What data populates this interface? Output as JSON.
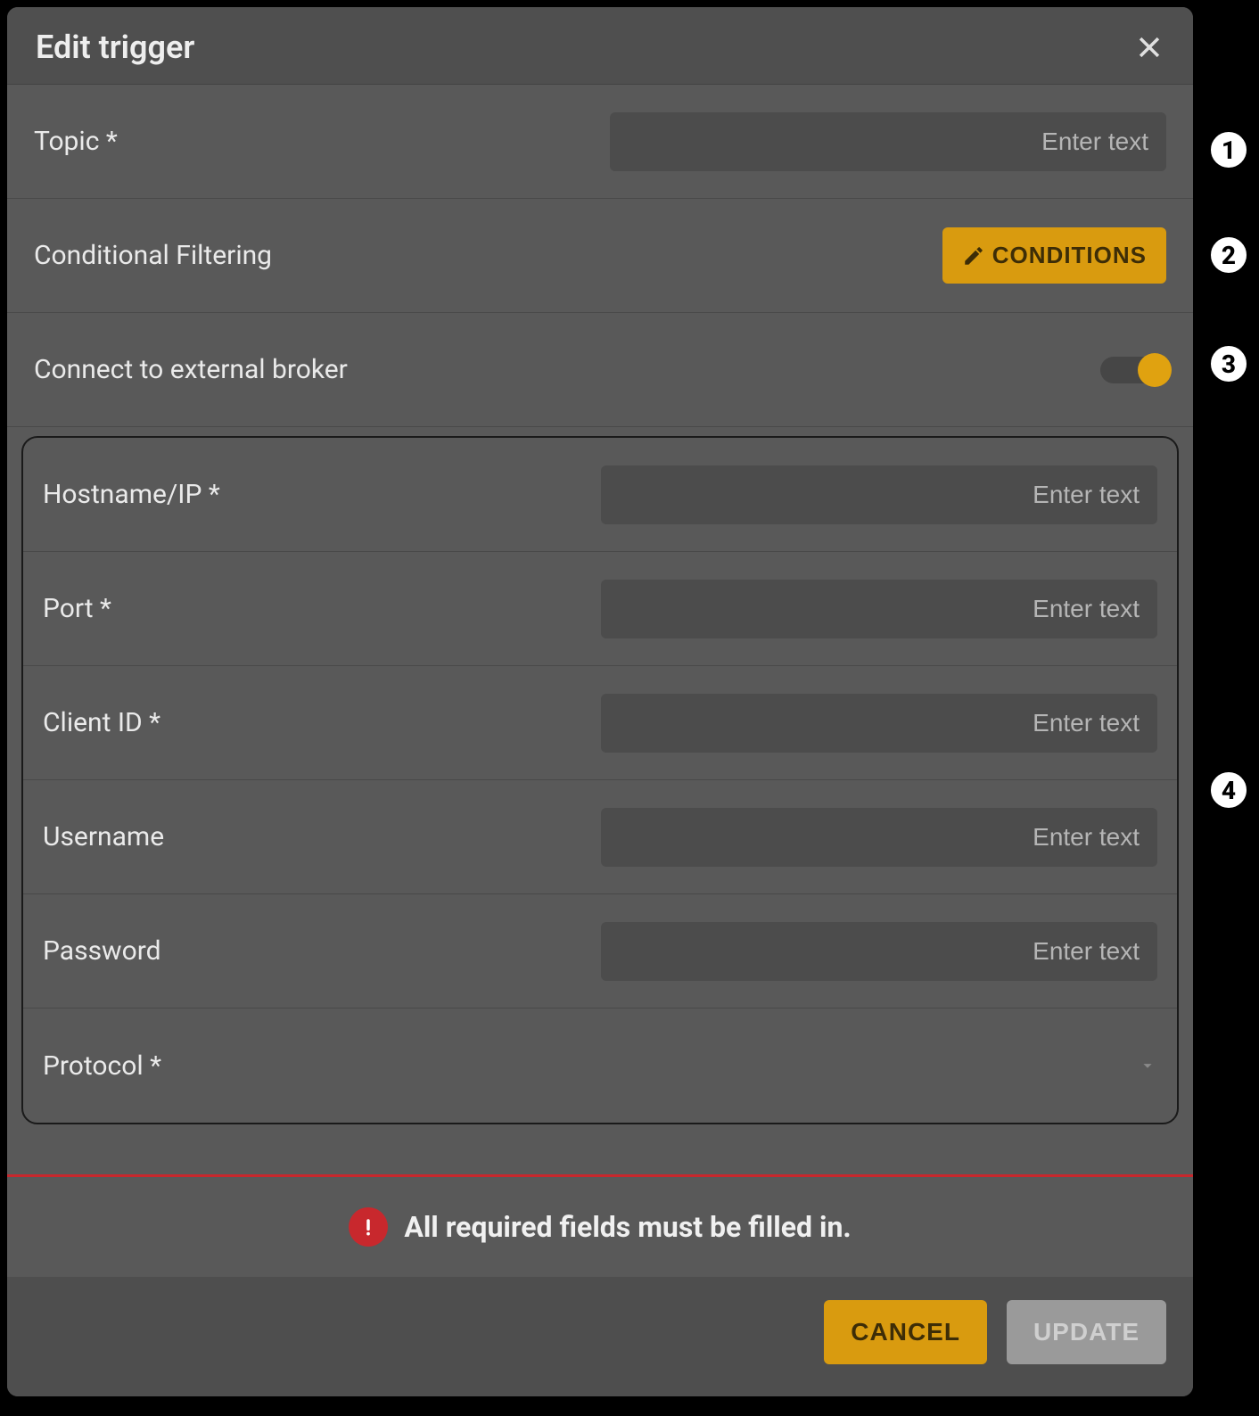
{
  "dialog": {
    "title": "Edit trigger"
  },
  "fields": {
    "topic": {
      "label": "Topic *",
      "placeholder": "Enter text"
    },
    "conditional": {
      "label": "Conditional Filtering",
      "button": "CONDITIONS"
    },
    "externalBroker": {
      "label": "Connect to external broker"
    },
    "hostname": {
      "label": "Hostname/IP *",
      "placeholder": "Enter text"
    },
    "port": {
      "label": "Port *",
      "placeholder": "Enter text"
    },
    "clientId": {
      "label": "Client ID *",
      "placeholder": "Enter text"
    },
    "username": {
      "label": "Username",
      "placeholder": "Enter text"
    },
    "password": {
      "label": "Password",
      "placeholder": "Enter text"
    },
    "protocol": {
      "label": "Protocol *"
    }
  },
  "error": {
    "message": "All required fields must be filled in."
  },
  "footer": {
    "cancel": "CANCEL",
    "update": "UPDATE"
  },
  "annotations": {
    "a1": "1",
    "a2": "2",
    "a3": "3",
    "a4": "4"
  }
}
